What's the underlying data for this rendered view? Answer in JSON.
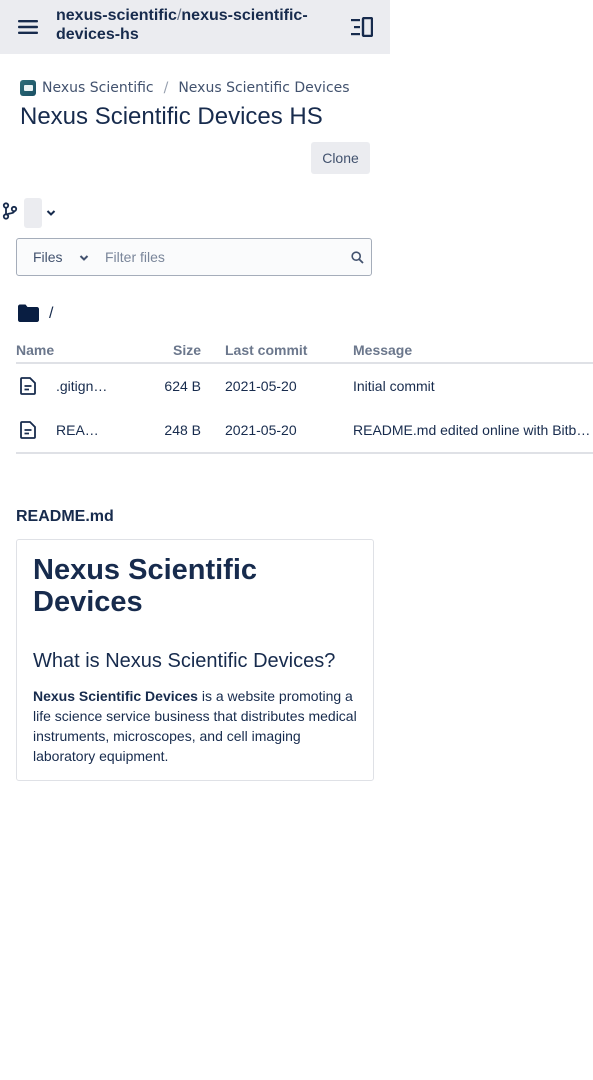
{
  "header": {
    "repo_owner": "nexus-scientific",
    "repo_separator": "/",
    "repo_name": "nexus-scientific-devices-hs"
  },
  "breadcrumb": {
    "workspace": "Nexus Scientific",
    "project": "Nexus Scientific Devices"
  },
  "page_title": "Nexus Scientific Devices HS",
  "clone_label": "Clone",
  "filter": {
    "type_selected": "Files",
    "placeholder": "Filter files"
  },
  "path": "/",
  "table": {
    "headers": {
      "name": "Name",
      "size": "Size",
      "last_commit": "Last commit",
      "message": "Message"
    },
    "rows": [
      {
        "name": ".gitignore",
        "size": "624 B",
        "last_commit": "2021-05-20",
        "message": "Initial commit"
      },
      {
        "name": "README.md",
        "size": "248 B",
        "last_commit": "2021-05-20",
        "message": "README.md edited online with Bitbucket"
      }
    ]
  },
  "readme": {
    "filename": "README.md",
    "h1": "Nexus Scientific Devices",
    "h2": "What is Nexus Scientific Devices?",
    "para_bold": "Nexus Scientific Devices",
    "para_rest": " is a website promoting a life science service business that distributes medical instruments, microscopes, and cell imaging laboratory equipment."
  },
  "icons": {
    "menu": "hamburger-menu-icon",
    "sidebar": "sidebar-toggle-icon",
    "branch": "branch-icon",
    "chevron": "chevron-down-icon",
    "search": "search-icon",
    "folder": "folder-icon",
    "file": "file-icon"
  }
}
